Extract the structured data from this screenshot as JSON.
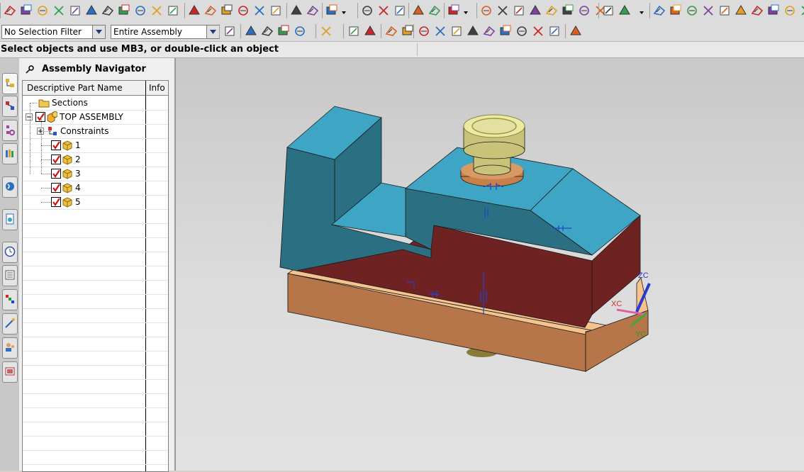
{
  "toolbar": {
    "selection_filter": {
      "value": "No Selection Filter"
    },
    "scope_filter": {
      "value": "Entire Assembly"
    }
  },
  "status": {
    "prompt": "Select objects and use MB3, or double-click an object"
  },
  "navigator": {
    "title": "Assembly Navigator",
    "columns": {
      "name": "Descriptive Part Name",
      "info": "Info"
    },
    "items": [
      {
        "label": "Sections",
        "icon": "folder-icon"
      },
      {
        "label": "TOP ASSEMBLY",
        "icon": "assembly-icon"
      },
      {
        "label": "Constraints",
        "icon": "constraints-icon"
      },
      {
        "label": "1",
        "icon": "part-icon"
      },
      {
        "label": "2",
        "icon": "part-icon"
      },
      {
        "label": "3",
        "icon": "part-icon"
      },
      {
        "label": "4",
        "icon": "part-icon"
      },
      {
        "label": "5",
        "icon": "part-icon"
      }
    ]
  },
  "viewport": {
    "axis_labels": {
      "zc": "ZC",
      "xc": "XC",
      "yc": "YC"
    },
    "colors": {
      "block_top": "#3ea6c4",
      "block_side": "#2a6f82",
      "block_red": "#6e2222",
      "base_top": "#f4c38e",
      "base_side": "#b6764a",
      "bushing_top": "#ece9a0",
      "bushing_side": "#c9c37a",
      "flange": "#c8804a"
    }
  }
}
